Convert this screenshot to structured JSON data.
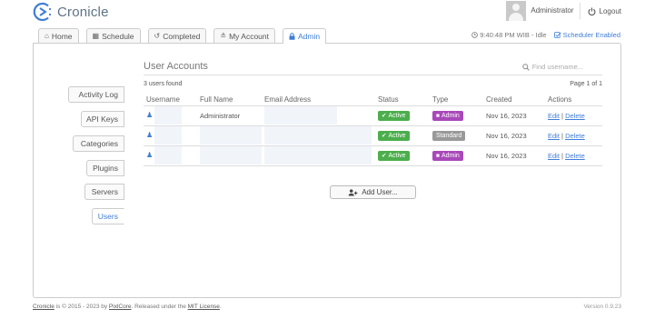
{
  "app": {
    "name": "Cronicle",
    "accent": "#3f7ed5"
  },
  "header": {
    "username": "Administrator",
    "logout_label": "Logout",
    "clock_text": "9:40:48 PM WIB - Idle",
    "scheduler_label": "Scheduler Enabled"
  },
  "tabs": [
    {
      "label": "Home",
      "icon": "home-icon"
    },
    {
      "label": "Schedule",
      "icon": "calendar-icon"
    },
    {
      "label": "Completed",
      "icon": "history-icon"
    },
    {
      "label": "My Account",
      "icon": "user-icon"
    },
    {
      "label": "Admin",
      "icon": "lock-icon",
      "active": true
    }
  ],
  "sidenav": [
    {
      "label": "Activity Log"
    },
    {
      "label": "API Keys"
    },
    {
      "label": "Categories"
    },
    {
      "label": "Plugins"
    },
    {
      "label": "Servers"
    },
    {
      "label": "Users",
      "active": true
    }
  ],
  "content": {
    "title": "User Accounts",
    "search_placeholder": "Find username...",
    "found_text": "3 users found",
    "page_text": "Page 1 of 1",
    "columns": [
      "Username",
      "Full Name",
      "Email Address",
      "Status",
      "Type",
      "Created",
      "Actions"
    ],
    "rows": [
      {
        "full_name": "Administrator",
        "status": "Active",
        "type": "Admin",
        "created": "Nov 16, 2023",
        "edit": "Edit",
        "delete": "Delete"
      },
      {
        "full_name": "",
        "status": "Active",
        "type": "Standard",
        "created": "Nov 16, 2023",
        "edit": "Edit",
        "delete": "Delete"
      },
      {
        "full_name": "",
        "status": "Active",
        "type": "Admin",
        "created": "Nov 16, 2023",
        "edit": "Edit",
        "delete": "Delete"
      }
    ],
    "add_button": "Add User..."
  },
  "footer": {
    "product": "Cronicle",
    "copyright": " is © 2015 - 2023 by ",
    "company": "PixlCore",
    "released": ". Released under the ",
    "license": "MIT License",
    "end": ".",
    "version": "Version 0.9.23"
  },
  "colors": {
    "active_badge": "#4cae4c",
    "admin_badge": "#a848b9",
    "standard_badge": "#999999"
  }
}
